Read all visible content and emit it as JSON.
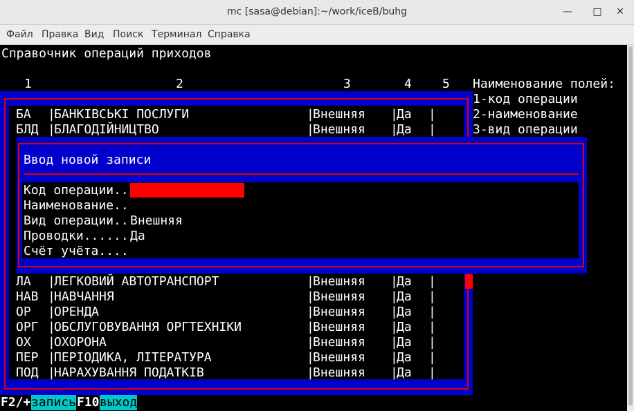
{
  "window": {
    "title": "mc [sasa@debian]:~/work/iceB/buhg"
  },
  "menubar": [
    "Файл",
    "Правка",
    "Вид",
    "Поиск",
    "Терминал",
    "Справка"
  ],
  "screen": {
    "heading": "Справочник операций приходов",
    "col_numbers": [
      "1",
      "2",
      "3",
      "4",
      "5"
    ],
    "legend_title": "Наименование полей:",
    "legend": [
      "1-код операции",
      "2-наименование",
      "3-вид операции"
    ],
    "rows_top": [
      {
        "code": "БА",
        "name": "БАНКІВСЬКІ ПОСЛУГИ",
        "type": "Внешняя",
        "post": "Да"
      },
      {
        "code": "БЛД",
        "name": "БЛАГОДІЙНИЦТВО",
        "type": "Внешняя",
        "post": "Да"
      }
    ],
    "rows_bottom": [
      {
        "code": "ЛА",
        "name": "ЛЕГКОВИЙ АВТОТРАНСПОРТ",
        "type": "Внешняя",
        "post": "Да"
      },
      {
        "code": "НАВ",
        "name": "НАВЧАННЯ",
        "type": "Внешняя",
        "post": "Да"
      },
      {
        "code": "ОР",
        "name": "ОРЕНДА",
        "type": "Внешняя",
        "post": "Да"
      },
      {
        "code": "ОРГ",
        "name": "ОБСЛУГОВУВАННЯ ОРГТЕХНІКИ",
        "type": "Внешняя",
        "post": "Да"
      },
      {
        "code": "ОХ",
        "name": "ОХОРОНА",
        "type": "Внешняя",
        "post": "Да"
      },
      {
        "code": "ПЕР",
        "name": "ПЕРІОДИКА, ЛІТЕРАТУРА",
        "type": "Внешняя",
        "post": "Да"
      },
      {
        "code": "ПОД",
        "name": "НАРАХУВАННЯ ПОДАТКІВ",
        "type": "Внешняя",
        "post": "Да"
      }
    ]
  },
  "dialog": {
    "title": "Ввод новой записи",
    "fields": [
      {
        "label": "Код операции..",
        "value": ""
      },
      {
        "label": "Наименование..",
        "value": ""
      },
      {
        "label": "Вид операции..",
        "value": "Внешняя"
      },
      {
        "label": "Проводки......",
        "value": "Да"
      },
      {
        "label": "Счёт учёта....",
        "value": ""
      }
    ]
  },
  "footer": {
    "keys": [
      {
        "key": "F2/+",
        "action": "запись"
      },
      {
        "key": "F10",
        "action": "выход"
      }
    ]
  },
  "colors": {
    "blue": "#0000cc",
    "red": "#e00000",
    "cyan": "#00c8c8"
  }
}
